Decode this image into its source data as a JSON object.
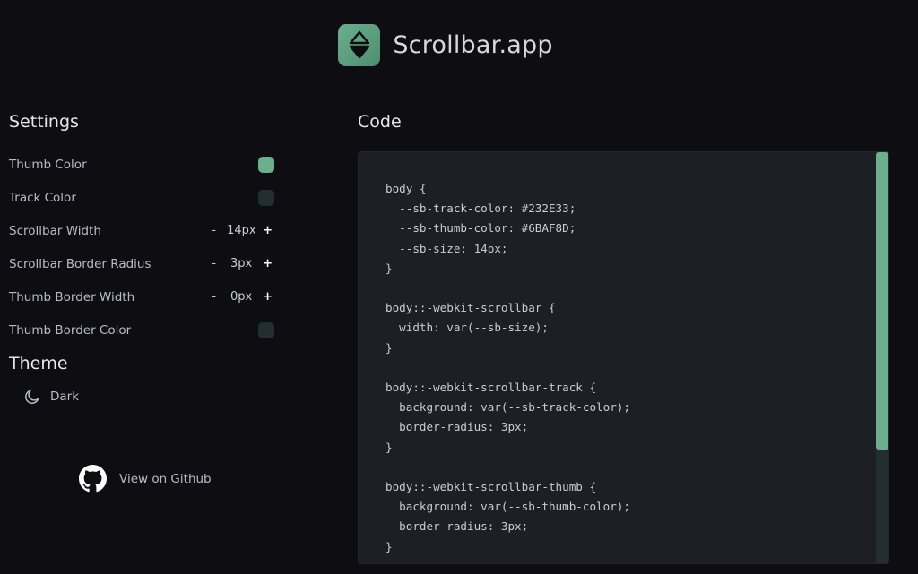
{
  "header": {
    "app_title": "Scrollbar.app"
  },
  "settings": {
    "title": "Settings",
    "rows": [
      {
        "label": "Thumb Color",
        "type": "color",
        "color": "#6BAF8D"
      },
      {
        "label": "Track Color",
        "type": "color",
        "color": "#232E33"
      },
      {
        "label": "Scrollbar Width",
        "type": "stepper",
        "minus": "-",
        "value": "14px",
        "plus": "+"
      },
      {
        "label": "Scrollbar Border Radius",
        "type": "stepper",
        "minus": "-",
        "value": "3px",
        "plus": "+"
      },
      {
        "label": "Thumb Border Width",
        "type": "stepper",
        "minus": "-",
        "value": "0px",
        "plus": "+"
      },
      {
        "label": "Thumb Border Color",
        "type": "color",
        "color": "#232E33"
      }
    ],
    "theme_title": "Theme",
    "theme_value": "Dark",
    "theme_icon": "moon-icon"
  },
  "github": {
    "label": "View on Github",
    "icon": "github-icon"
  },
  "code": {
    "title": "Code",
    "scroll_position": 0.0,
    "visible_fraction": 0.72,
    "lines": [
      "body {",
      "  --sb-track-color: #232E33;",
      "  --sb-thumb-color: #6BAF8D;",
      "  --sb-size: 14px;",
      "}",
      "",
      "body::-webkit-scrollbar {",
      "  width: var(--sb-size);",
      "}",
      "",
      "body::-webkit-scrollbar-track {",
      "  background: var(--sb-track-color);",
      "  border-radius: 3px;",
      "}",
      "",
      "body::-webkit-scrollbar-thumb {",
      "  background: var(--sb-thumb-color);",
      "  border-radius: 3px;",
      "}"
    ]
  },
  "colors": {
    "accent": "#6BAF8D",
    "track": "#232E33",
    "background": "#0E0E12",
    "panel": "#1C1F24"
  }
}
